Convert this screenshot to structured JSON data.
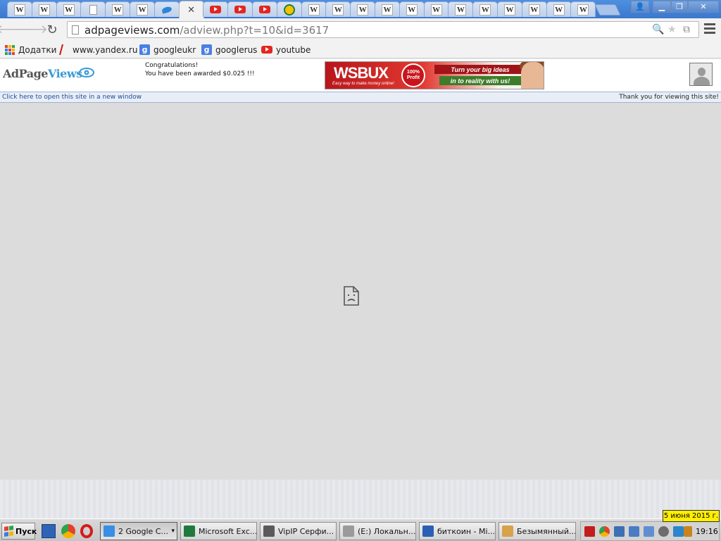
{
  "browser": {
    "tabs": [
      {
        "icon": "w",
        "letter": "W"
      },
      {
        "icon": "w",
        "letter": "W"
      },
      {
        "icon": "w",
        "letter": "W"
      },
      {
        "icon": "doc",
        "letter": ""
      },
      {
        "icon": "w",
        "letter": "W"
      },
      {
        "icon": "w",
        "letter": "W"
      },
      {
        "icon": "bird",
        "letter": ""
      },
      {
        "icon": "close",
        "letter": "✕"
      },
      {
        "icon": "yt",
        "letter": ""
      },
      {
        "icon": "yt",
        "letter": ""
      },
      {
        "icon": "yt",
        "letter": ""
      },
      {
        "icon": "sun",
        "letter": ""
      },
      {
        "icon": "w",
        "letter": "W"
      },
      {
        "icon": "w",
        "letter": "W"
      },
      {
        "icon": "w",
        "letter": "W"
      },
      {
        "icon": "w",
        "letter": "W"
      },
      {
        "icon": "w",
        "letter": "W"
      },
      {
        "icon": "w",
        "letter": "W"
      },
      {
        "icon": "w",
        "letter": "W"
      },
      {
        "icon": "w",
        "letter": "W"
      },
      {
        "icon": "w",
        "letter": "W"
      },
      {
        "icon": "w",
        "letter": "W"
      },
      {
        "icon": "w",
        "letter": "W"
      },
      {
        "icon": "w",
        "letter": "W"
      }
    ],
    "active_tab_index": 7,
    "url_host": "adpageviews.com",
    "url_path": "/adview.php?t=10&id=3617",
    "bookmarks": {
      "apps": "Додатки",
      "yandex": "www.yandex.ru",
      "googleukr": "googleukr",
      "googlerus": "googlerus",
      "youtube": "youtube"
    }
  },
  "page": {
    "logo_part1": "AdPage",
    "logo_part2": "Views",
    "congrats_title": "Congratulations!",
    "congrats_text": "You have been awarded $0.025 !!!",
    "banner": {
      "brand": "WSBUX",
      "subtitle": "Easy way to make money online!",
      "badge": "100% Profit",
      "line1": "Turn your big ideas",
      "line2": "in to reality with us!"
    },
    "open_link": "Click here to open this site in a new window",
    "thanks": "Thank you for viewing this site!"
  },
  "taskbar": {
    "start": "Пуск",
    "tasks": [
      {
        "label": "2 Google C...",
        "color": "#3a8ee6"
      },
      {
        "label": "Microsoft Exc...",
        "color": "#1e7a3c"
      },
      {
        "label": "VipIP Серфи...",
        "color": "#5a5a5a"
      },
      {
        "label": "(E:) Локальн...",
        "color": "#9a9a9a"
      },
      {
        "label": "биткоин - Mi...",
        "color": "#2b5fb4"
      },
      {
        "label": "Безымянный...",
        "color": "#d8a24a"
      }
    ],
    "clock": "19:16",
    "date_tooltip": "5 июня 2015 г."
  },
  "colors": {
    "tab_strip": "#3a78cf",
    "page_background": "#dcdcdc",
    "link": "#1a4ea0"
  }
}
